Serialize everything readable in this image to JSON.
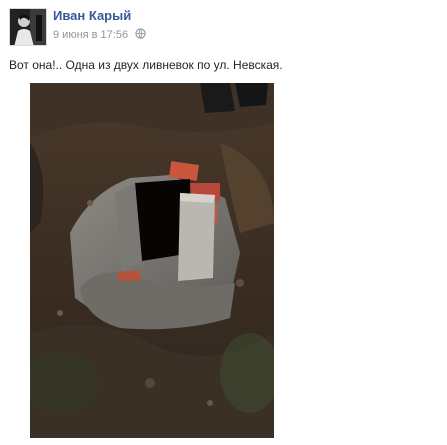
{
  "post": {
    "author_name": "Иван Карый",
    "timestamp": "9 июня в 17:56",
    "privacy_icon": "globe-icon",
    "text": "Вот она!.. Одна из двух ливневок по ул. Невская.",
    "photo_description_icon": "photo"
  },
  "colors": {
    "author": "#365899",
    "meta": "#90949c",
    "text": "#1d2129"
  }
}
